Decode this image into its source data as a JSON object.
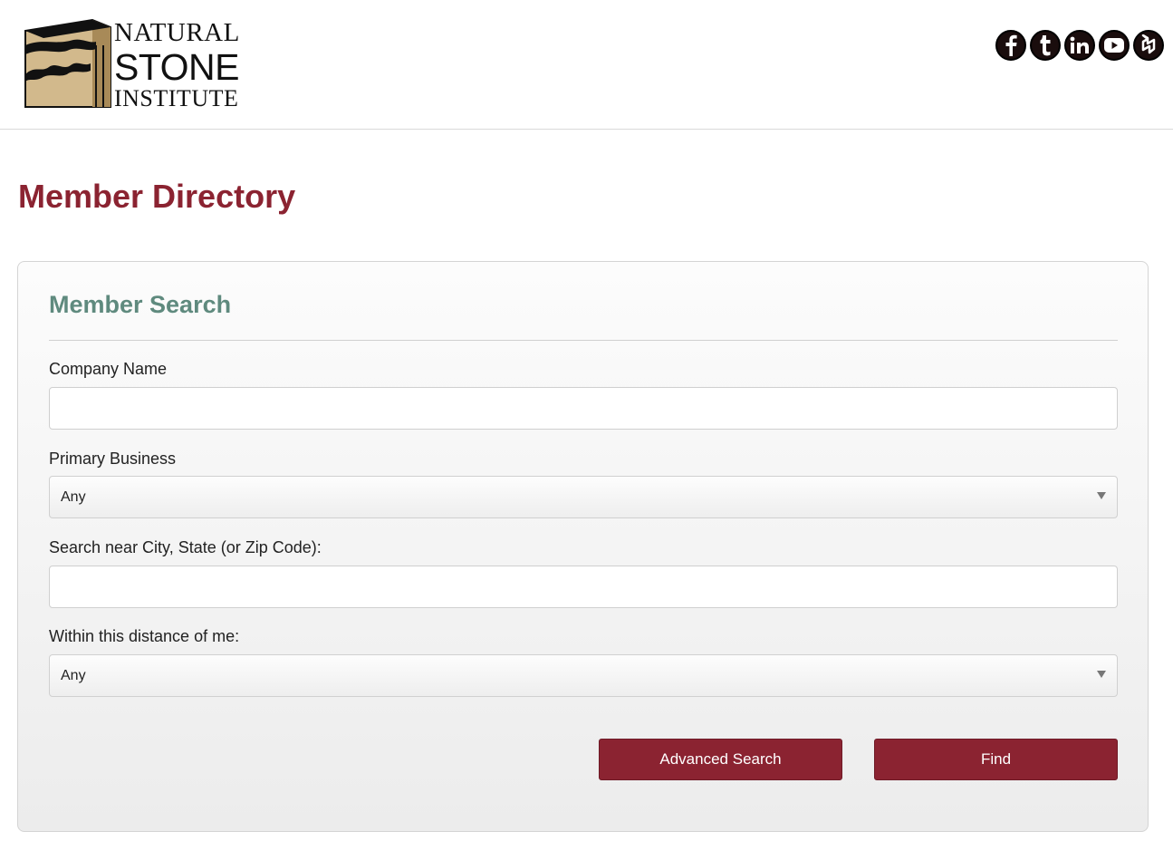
{
  "header": {
    "logo": {
      "line1": "NATURAL",
      "line2": "STONE",
      "line3": "INSTITUTE"
    },
    "social": [
      {
        "name": "facebook-icon",
        "glyph": "f"
      },
      {
        "name": "tumblr-icon",
        "glyph": "t"
      },
      {
        "name": "linkedin-icon",
        "glyph": "in"
      },
      {
        "name": "youtube-icon",
        "glyph": "play"
      },
      {
        "name": "houzz-icon",
        "glyph": "houzz"
      }
    ]
  },
  "page": {
    "title": "Member Directory"
  },
  "search": {
    "title": "Member Search",
    "company_label": "Company Name",
    "company_value": "",
    "business_label": "Primary Business",
    "business_value": "Any",
    "location_label": "Search near City, State (or Zip Code):",
    "location_value": "",
    "distance_label": "Within this distance of me:",
    "distance_value": "Any",
    "advanced_label": "Advanced Search",
    "find_label": "Find"
  },
  "colors": {
    "brand": "#8b2331",
    "accent_green": "#5f8a7e",
    "logo_tan": "#d2b98c"
  }
}
